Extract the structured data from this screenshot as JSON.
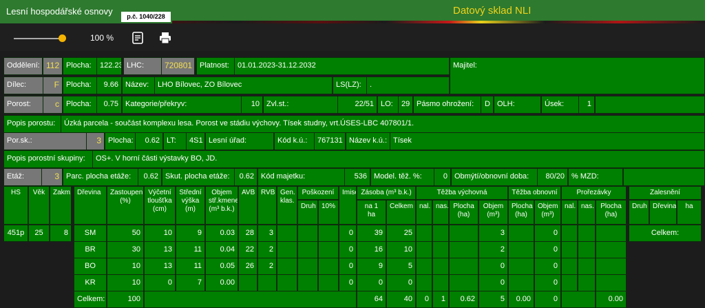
{
  "header": {
    "title": "Lesní hospodářské osnovy",
    "badge": "p.č. 1040/228",
    "app": "Datový sklad NLI"
  },
  "toolbar": {
    "zoom": "100 %"
  },
  "row1": {
    "oddeleni_l": "Oddělení:",
    "oddeleni_v": "112",
    "plocha_l": "Plocha:",
    "plocha_v": "122.23",
    "lhc_l": "LHC:",
    "lhc_v": "720801",
    "platnost_l": "Platnost:",
    "platnost_v": "01.01.2023-31.12.2032",
    "majitel_l": "Majitel:"
  },
  "row2": {
    "dilec_l": "Dílec:",
    "dilec_v": "F",
    "plocha_l": "Plocha:",
    "plocha_v": "9.66",
    "nazev_l": "Název:",
    "nazev_v": "LHO Bílovec, ZO Bílovec",
    "ls_l": "LS(LZ):",
    "ls_v": "."
  },
  "row3": {
    "porost_l": "Porost:",
    "porost_v": "c",
    "plocha_l": "Plocha:",
    "plocha_v": "0.75",
    "kat_l": "Kategorie/překryv:",
    "kat_v": "10",
    "zvl_l": "Zvl.st.:",
    "zvl_v": "22/51",
    "lo_l": "LO:",
    "lo_v": "29",
    "pasmo_l": "Pásmo ohrožení:",
    "pasmo_v": "D",
    "olh_l": "OLH:",
    "usek_l": "Úsek:",
    "usek_v": "1"
  },
  "row4": {
    "popis_l": "Popis porostu:",
    "popis_v": "Úzká parcela - součást komplexu lesa. Porost ve stádiu výchovy. Tísek studny, vrt.ÚSES-LBC 407801/1."
  },
  "row5": {
    "porsk_l": "Por.sk.:",
    "porsk_v": "3",
    "plocha_l": "Plocha:",
    "plocha_v": "0.62",
    "lt_l": "LT:",
    "lt_v": "4S1",
    "urad_l": "Lesní úřad:",
    "kod_l": "Kód k.ú.:",
    "kod_v": "767131",
    "nazev_l": "Název k.ú.:",
    "nazev_v": "Tísek"
  },
  "row6": {
    "popis_l": "Popis porostní skupiny:",
    "popis_v": "OS+. V horní části výstavky BO, JD."
  },
  "row7": {
    "etaz_l": "Etáž:",
    "etaz_v": "3",
    "parc_l": "Parc. plocha etáže:",
    "parc_v": "0.62",
    "skut_l": "Skut. plocha etáže:",
    "skut_v": "0.62",
    "kod_l": "Kód majetku:",
    "kod_v": "536",
    "model_l": "Model. těž. %:",
    "model_v": "0",
    "obmyti_l": "Obmýtí/obnovní doba:",
    "obmyti_v": "80/20",
    "mzd_l": "% MZD:"
  },
  "left_table": {
    "headers": [
      "HS",
      "Věk",
      "Zakm."
    ],
    "row": [
      "451p",
      "25",
      "8"
    ]
  },
  "table": {
    "headers": {
      "dreviny": "Dřevina",
      "zastoupeni": "Zastoupení (%)",
      "vycetni": "Výčetní tloušťka (cm)",
      "stredni": "Střední výška (m)",
      "objem": "Objem stř.kmene (m³ b.k.)",
      "avb": "AVB",
      "rvb": "RVB",
      "gen": "Gen. klas.",
      "poskozeni": "Poškození",
      "druh": "Druh",
      "pct10": "10%",
      "imise": "Imise",
      "zasoba": "Zásoba (m³ b.k.)",
      "na1ha": "na 1 ha",
      "celkem": "Celkem",
      "tezba_vych": "Těžba výchovná",
      "nal": "nal.",
      "nas": "nas.",
      "plocha_ha": "Plocha (ha)",
      "objem_m3": "Objem (m³)",
      "tezba_obn": "Těžba obnovní",
      "prorezavky": "Prořezávky",
      "zalesneni": "Zalesnění",
      "zal_druh": "Druh",
      "zal_dreviny": "Dřevina",
      "zal_ha": "ha",
      "zal_celkem": "Celkem:"
    },
    "rows": [
      {
        "drevina": "SM",
        "zast": "50",
        "tl": "10",
        "vys": "9",
        "obj": "0.03",
        "avb": "28",
        "rvb": "3",
        "imise": "0",
        "na1ha": "39",
        "celkem": "25",
        "tv_obj": "3",
        "to_obj": "0"
      },
      {
        "drevina": "BR",
        "zast": "30",
        "tl": "13",
        "vys": "11",
        "obj": "0.04",
        "avb": "22",
        "rvb": "2",
        "imise": "0",
        "na1ha": "16",
        "celkem": "10",
        "tv_obj": "2",
        "to_obj": "0"
      },
      {
        "drevina": "BO",
        "zast": "10",
        "tl": "13",
        "vys": "11",
        "obj": "0.05",
        "avb": "26",
        "rvb": "2",
        "imise": "0",
        "na1ha": "9",
        "celkem": "5",
        "tv_obj": "0",
        "to_obj": "0"
      },
      {
        "drevina": "KR",
        "zast": "10",
        "tl": "0",
        "vys": "7",
        "obj": "0.00",
        "avb": "",
        "rvb": "",
        "imise": "0",
        "na1ha": "0",
        "celkem": "0",
        "tv_obj": "0",
        "to_obj": "0"
      }
    ],
    "totals": {
      "label": "Celkem:",
      "zast": "100",
      "na1ha": "64",
      "celkem": "40",
      "nal": "0",
      "nas": "1",
      "plocha": "0.62",
      "tv_obj": "5",
      "to_plocha": "0.00",
      "to_obj": "0",
      "pr_plocha": "0.00"
    }
  }
}
